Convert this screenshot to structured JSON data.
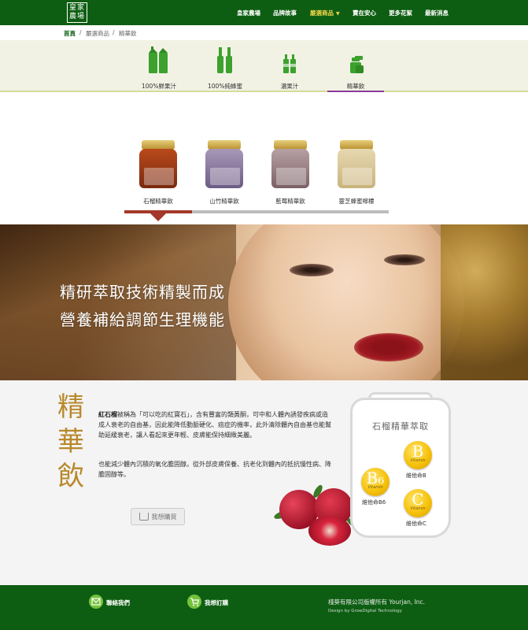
{
  "logo": {
    "text": "皇家農場"
  },
  "nav": [
    {
      "label": "皇家農場"
    },
    {
      "label": "品牌故事"
    },
    {
      "label": "嚴選商品",
      "active": true,
      "has_dropdown": true
    },
    {
      "label": "賣在安心"
    },
    {
      "label": "更多花絮"
    },
    {
      "label": "最新消息"
    }
  ],
  "breadcrumb": {
    "home": "首頁",
    "sep": "/",
    "level2": "嚴選商品",
    "level3": "精華飲"
  },
  "categories": [
    {
      "label": "100%鮮果汁",
      "icon": "juice-bottles-icon"
    },
    {
      "label": "100%純蜂蜜",
      "icon": "honey-bottles-icon"
    },
    {
      "label": "濃果汁",
      "icon": "concentrate-bottles-icon"
    },
    {
      "label": "精華飲",
      "icon": "essence-jars-icon",
      "active": true
    }
  ],
  "products": [
    {
      "name": "石榴精華飲",
      "active": true
    },
    {
      "name": "山竹精華飲"
    },
    {
      "name": "藍莓精華飲"
    },
    {
      "name": "靈芝蜂蜜檸檬"
    }
  ],
  "hero": {
    "line1": "精研萃取技術精製而成",
    "line2": "營養補給調節生理機能"
  },
  "info": {
    "vertical_title": [
      "精",
      "華",
      "飲"
    ],
    "para1_bold": "紅石榴",
    "para1_rest": "被稱為「可以吃的紅寶石」，含有豐富的類黃酮，可中和人體內誘發疾病或造成人衰老的自由基，因此能降低動脈硬化、癌症的機率，此外清除體內自由基也能幫助延緩衰老，讓人看起來更年輕、皮膚能保持細緻美麗。",
    "para2": "也能減少體內沉積的氧化膽固醇。從外部皮膚保養、抗老化到體內的抵抗慢性病、降膽固醇等。",
    "buy_label": "我想購買"
  },
  "bottle": {
    "title": "石榴精華萃取",
    "vitamins": [
      {
        "letter": "B",
        "sub": "Vitamin",
        "label": "維他命B"
      },
      {
        "letter": "B₆",
        "sub": "Vitamin",
        "label": "維他命B6"
      },
      {
        "letter": "C",
        "sub": "Vitamin",
        "label": "維他命C"
      }
    ]
  },
  "footer": {
    "contact_label": "聯絡我們",
    "order_label": "我想訂購",
    "copyright": "棧葵有限公司版權所有 Yourjan, Inc.",
    "design": "Design by GrowDigital Technology"
  },
  "colors": {
    "brand_green": "#0d5e12",
    "accent_gold": "#b8892c",
    "nav_active": "#f3d54b",
    "product_active": "#a4382a"
  }
}
